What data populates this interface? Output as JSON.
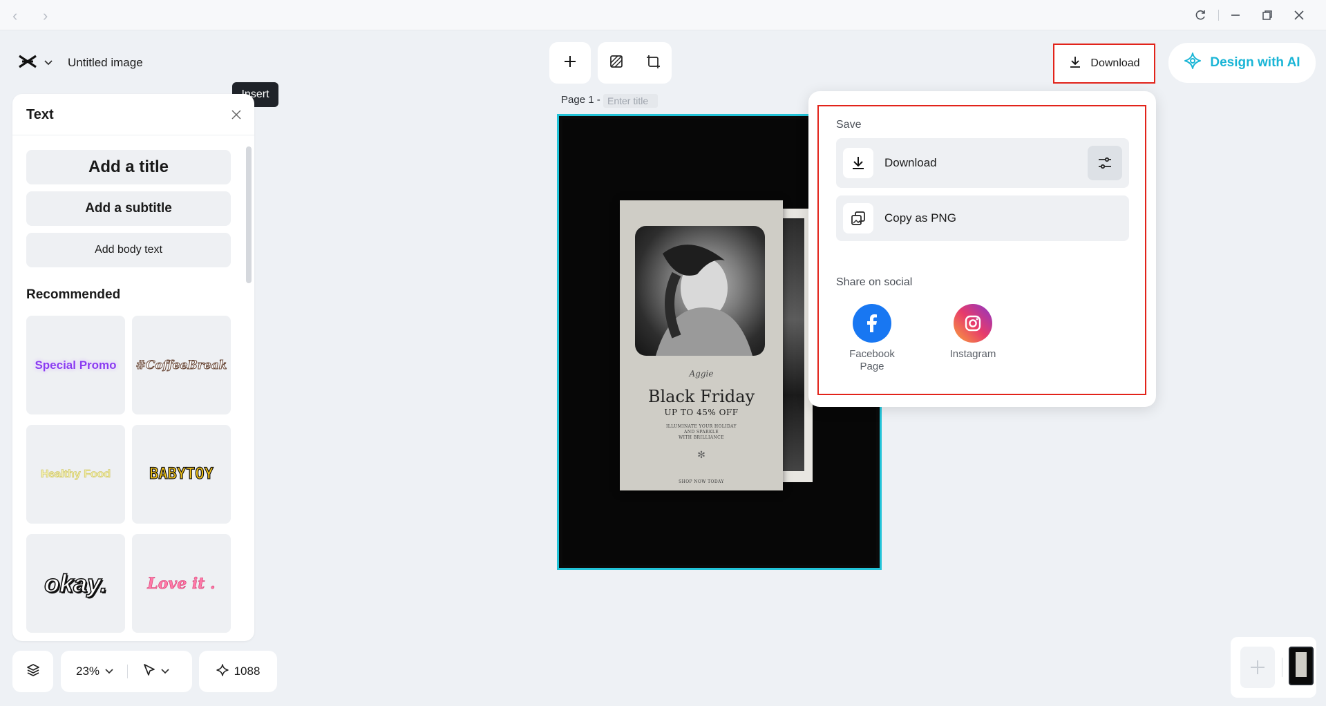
{
  "app": {
    "document_title": "Untitled image",
    "tooltip": "Insert"
  },
  "text_panel": {
    "title": "Text",
    "add_title": "Add a title",
    "add_subtitle": "Add a subtitle",
    "add_body": "Add body text",
    "recommended_label": "Recommended",
    "styles": [
      "Special Promo",
      "#CoffeeBreak",
      "Healthy Food",
      "BABYTOY",
      "okay.",
      "Love it ."
    ]
  },
  "toolbar_bottom": {
    "zoom": "23%",
    "credits": "1088"
  },
  "page": {
    "label": "Page 1 -",
    "title_placeholder": "Enter title"
  },
  "poster": {
    "script": "Aggie",
    "headline": "Black Friday",
    "subheadline": "UP TO 45% OFF",
    "body_lines": [
      "ILLUMINATE YOUR HOLIDAY",
      "AND SPARKLE",
      "WITH BRILLIANCE"
    ],
    "footer": "SHOP NOW TODAY"
  },
  "header": {
    "download_label": "Download",
    "ai_label": "Design with AI"
  },
  "download_menu": {
    "save_label": "Save",
    "download_label": "Download",
    "copy_label": "Copy as PNG",
    "share_label": "Share on social",
    "social": [
      {
        "label": "Facebook Page",
        "color": "#1877f2"
      },
      {
        "label": "Instagram",
        "color": "#d62976"
      }
    ]
  },
  "colors": {
    "accent": "#1ab5d6",
    "highlight": "#e2231a",
    "selection": "#22c3d8"
  }
}
